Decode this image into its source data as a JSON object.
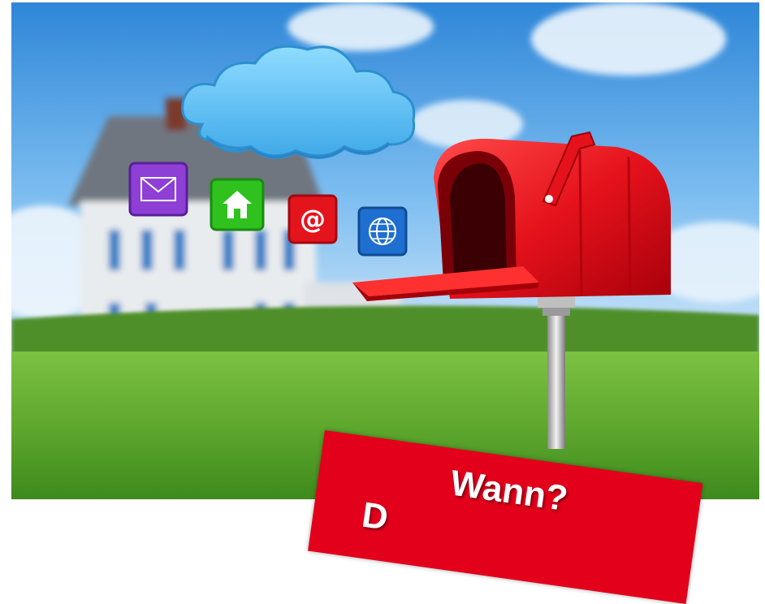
{
  "banner": {
    "line1": "Wann?",
    "line2": "D"
  },
  "icons": [
    {
      "name": "envelope-icon",
      "color": "#8e3fd6"
    },
    {
      "name": "home-icon",
      "color": "#2fc21f"
    },
    {
      "name": "at-sign-icon",
      "color": "#e4141d",
      "glyph": "@"
    },
    {
      "name": "globe-icon",
      "color": "#1e6fd0"
    }
  ],
  "colors": {
    "sky": "#5aa6e6",
    "grass": "#5fa82e",
    "mailbox": "#e5121c",
    "cloud": "#6cc7f5",
    "banner": "#e3001b"
  }
}
